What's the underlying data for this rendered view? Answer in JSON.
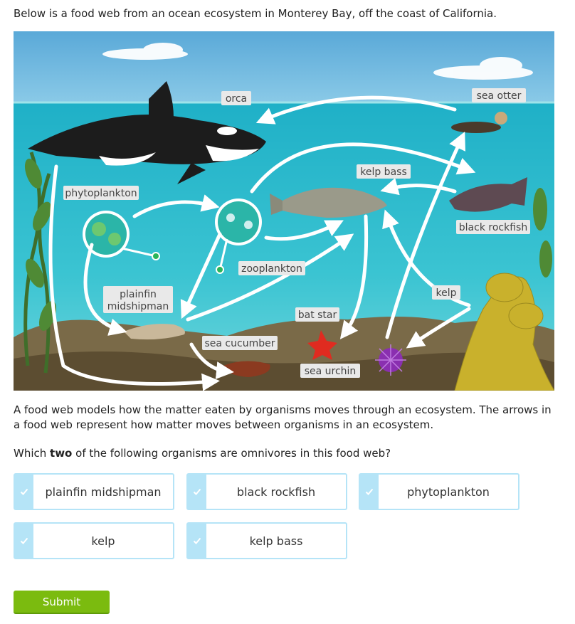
{
  "intro": "Below is a food web from an ocean ecosystem in Monterey Bay, off the coast of California.",
  "foodweb": {
    "labels": {
      "orca": "orca",
      "sea_otter": "sea otter",
      "kelp_bass": "kelp bass",
      "phytoplankton": "phytoplankton",
      "black_rockfish": "black rockfish",
      "zooplankton": "zooplankton",
      "plainfin_line1": "plainfin",
      "plainfin_line2": "midshipman",
      "kelp": "kelp",
      "bat_star": "bat star",
      "sea_cucumber": "sea cucumber",
      "sea_urchin": "sea urchin"
    },
    "colors": {
      "sky": "#6fb6dc",
      "water": "#2eb8c6",
      "seafloor": "#6b5a3a",
      "arrow": "#ffffff",
      "kelp": "#c9b12c"
    }
  },
  "paragraph": "A food web models how the matter eaten by organisms moves through an ecosystem. The arrows in a food web represent how matter moves between organisms in an ecosystem.",
  "question": {
    "before": "Which ",
    "bold": "two",
    "after": " of the following organisms are omnivores in this food web?"
  },
  "options": [
    {
      "label": "plainfin midshipman",
      "icon": "check-icon"
    },
    {
      "label": "black rockfish",
      "icon": "check-icon"
    },
    {
      "label": "phytoplankton",
      "icon": "check-icon"
    },
    {
      "label": "kelp",
      "icon": "check-icon"
    },
    {
      "label": "kelp bass",
      "icon": "check-icon"
    }
  ],
  "submit_label": "Submit",
  "accent_color": "#7bbb0f",
  "option_border_color": "#b5e4f7"
}
